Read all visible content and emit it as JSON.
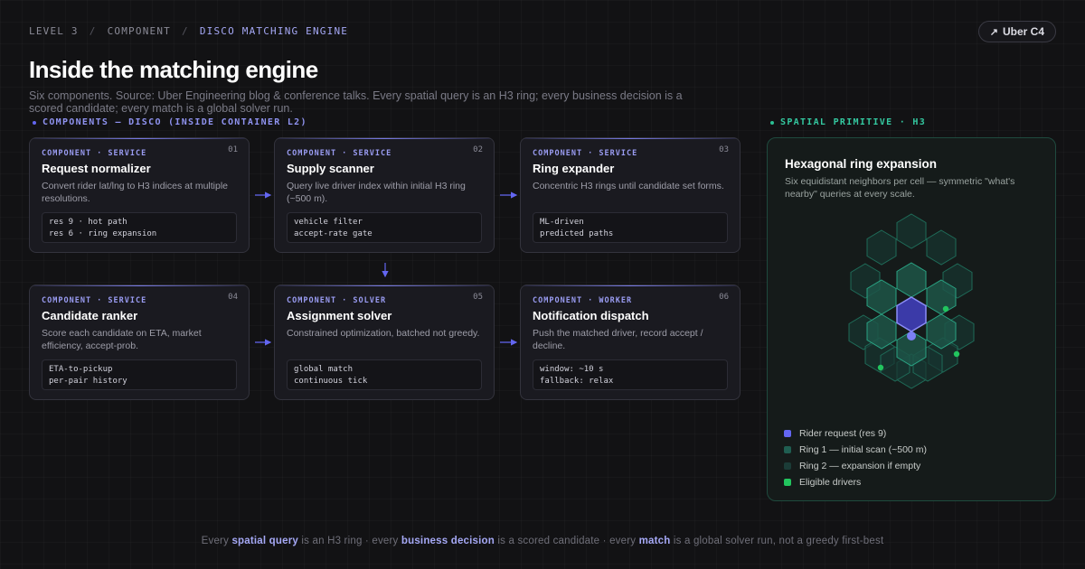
{
  "breadcrumb": {
    "level": "LEVEL 3",
    "separator": "/",
    "type": "COMPONENT",
    "current": "DISCO MATCHING ENGINE"
  },
  "chip": {
    "icon": "arrow-up-right-icon",
    "arrow": "↗",
    "label": "Uber C4"
  },
  "title": "Inside the matching engine",
  "subtitle": "Six components. Source: Uber Engineering blog & conference talks. Every spatial query is an H3 ring; every business decision is a scored candidate; every match is a global solver run.",
  "sections": {
    "components": "COMPONENTS — DISCO (INSIDE CONTAINER L2)",
    "spatial": "SPATIAL PRIMITIVE · H3"
  },
  "components": [
    {
      "kind": "COMPONENT · SERVICE",
      "num": "01",
      "name": "Request normalizer",
      "desc": "Convert rider lat/lng to H3 indices at multiple resolutions.",
      "code": [
        "res 9 · hot path",
        "res 6 · ring expansion"
      ]
    },
    {
      "kind": "COMPONENT · SERVICE",
      "num": "02",
      "name": "Supply scanner",
      "desc": "Query live driver index within initial H3 ring (~500 m).",
      "code": [
        "vehicle filter",
        "accept-rate gate"
      ]
    },
    {
      "kind": "COMPONENT · SERVICE",
      "num": "03",
      "name": "Ring expander",
      "desc": "Concentric H3 rings until candidate set forms.",
      "code": [
        "ML-driven",
        "predicted paths"
      ]
    },
    {
      "kind": "COMPONENT · SERVICE",
      "num": "04",
      "name": "Candidate ranker",
      "desc": "Score each candidate on ETA, market efficiency, accept-prob.",
      "code": [
        "ETA-to-pickup",
        "per-pair history"
      ]
    },
    {
      "kind": "COMPONENT · SOLVER",
      "num": "05",
      "name": "Assignment solver",
      "desc": "Constrained optimization, batched not greedy.",
      "code": [
        "global match",
        "continuous tick"
      ]
    },
    {
      "kind": "COMPONENT · WORKER",
      "num": "06",
      "name": "Notification dispatch",
      "desc": "Push the matched driver, record accept / decline.",
      "code": [
        "window: ~10 s",
        "fallback: relax"
      ]
    }
  ],
  "spatial": {
    "title": "Hexagonal ring expansion",
    "desc": "Six equidistant neighbors per cell — symmetric \"what's nearby\" queries at every scale.",
    "legend": [
      {
        "label": "Rider request (res 9)",
        "color": "#6366f1"
      },
      {
        "label": "Ring 1 — initial scan (~500 m)",
        "color": "#1f5e51"
      },
      {
        "label": "Ring 2 — expansion if empty",
        "color": "#1b3c37"
      },
      {
        "label": "Eligible drivers",
        "color": "#22c55e"
      }
    ]
  },
  "footer": {
    "p1": "Every ",
    "k1": "spatial query",
    "p2": " is an H3 ring · every ",
    "k2": "business decision",
    "p3": " is a scored candidate · every ",
    "k3": "match",
    "p4": " is a global solver run, not a greedy first-best"
  },
  "colors": {
    "accent": "#6366f1",
    "accent_text": "#a5a8f5",
    "teal": "#2bbf93",
    "driver": "#22c55e"
  }
}
